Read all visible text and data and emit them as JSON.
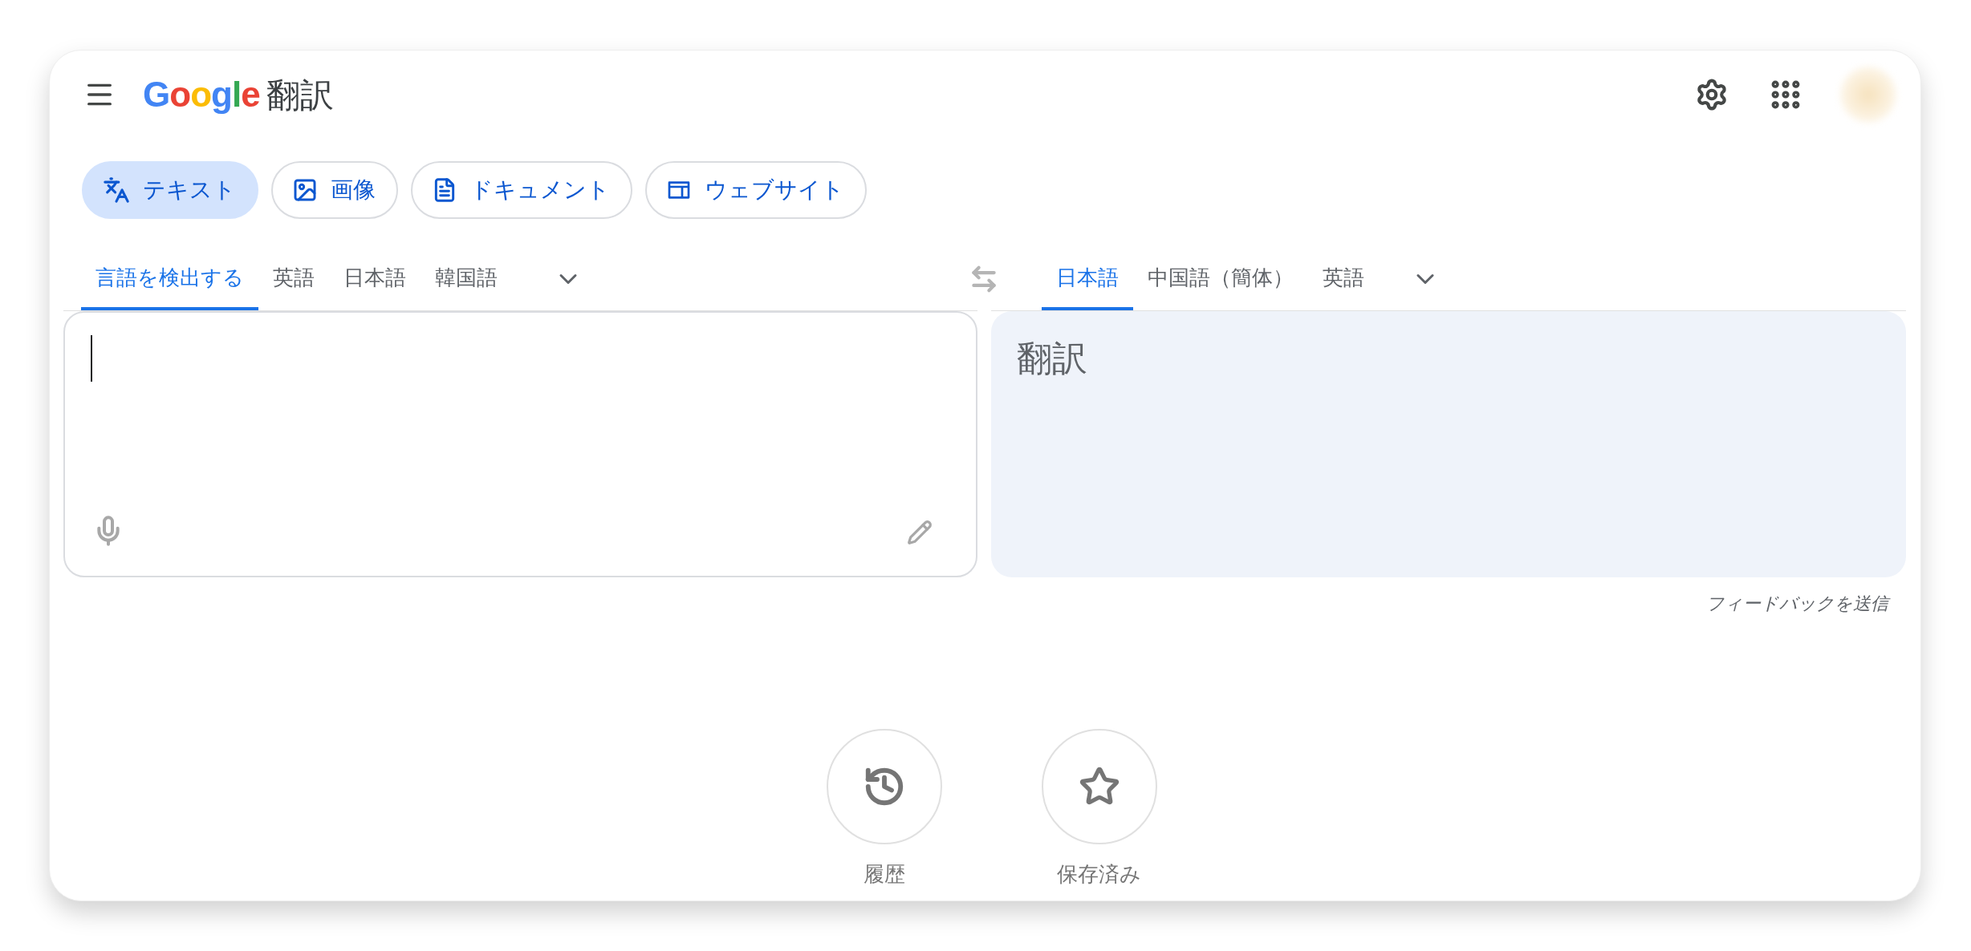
{
  "header": {
    "logo": "Google",
    "title": "翻訳"
  },
  "modes": [
    {
      "kind": "text",
      "label": "テキスト",
      "selected": true
    },
    {
      "kind": "image",
      "label": "画像",
      "selected": false
    },
    {
      "kind": "document",
      "label": "ドキュメント",
      "selected": false
    },
    {
      "kind": "website",
      "label": "ウェブサイト",
      "selected": false
    }
  ],
  "source_languages": [
    {
      "label": "言語を検出する",
      "selected": true
    },
    {
      "label": "英語",
      "selected": false
    },
    {
      "label": "日本語",
      "selected": false
    },
    {
      "label": "韓国語",
      "selected": false
    }
  ],
  "target_languages": [
    {
      "label": "日本語",
      "selected": true
    },
    {
      "label": "中国語（簡体）",
      "selected": false
    },
    {
      "label": "英語",
      "selected": false
    }
  ],
  "output": {
    "placeholder": "翻訳"
  },
  "feedback_link": "フィードバックを送信",
  "bottom_actions": [
    {
      "kind": "history",
      "label": "履歴"
    },
    {
      "kind": "saved",
      "label": "保存済み"
    }
  ]
}
